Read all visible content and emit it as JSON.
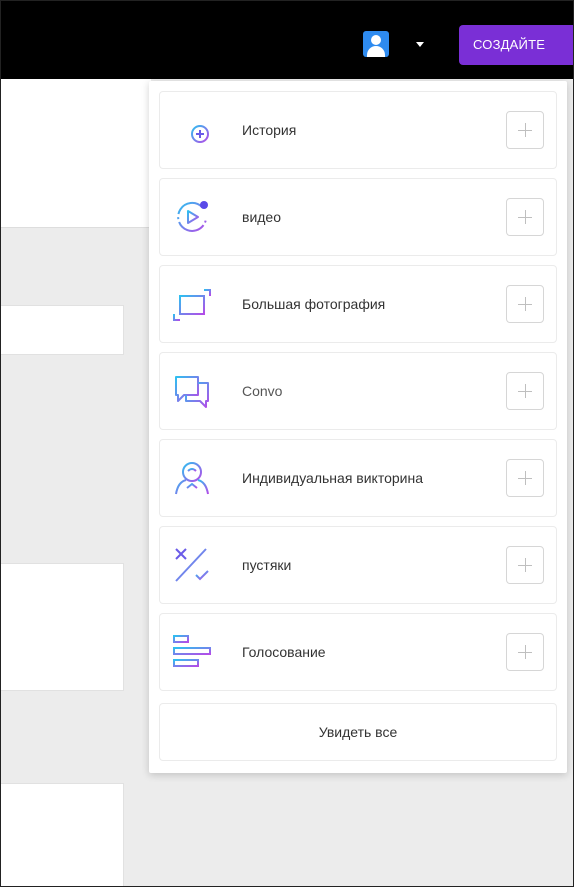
{
  "header": {
    "create_button_label": "СОЗДАЙТЕ",
    "avatar_icon": "user-avatar-icon",
    "dropdown_icon": "caret-down-icon"
  },
  "colors": {
    "topbar": "#000000",
    "create_button": "#7a2fd6",
    "avatar": "#2e8bf0",
    "icon_gradient_start": "#2ec0f0",
    "icon_gradient_end": "#b44be8"
  },
  "menu": {
    "items": [
      {
        "label": "История",
        "icon": "story-icon"
      },
      {
        "label": "видео",
        "icon": "video-icon"
      },
      {
        "label": "Большая фотография",
        "icon": "big-photo-icon"
      },
      {
        "label": "Convo",
        "icon": "chat-icon"
      },
      {
        "label": "Индивидуальная викторина",
        "icon": "personality-quiz-icon"
      },
      {
        "label": "пустяки",
        "icon": "trivia-icon"
      },
      {
        "label": "Голосование",
        "icon": "poll-icon"
      }
    ],
    "see_all_label": "Увидеть все"
  }
}
